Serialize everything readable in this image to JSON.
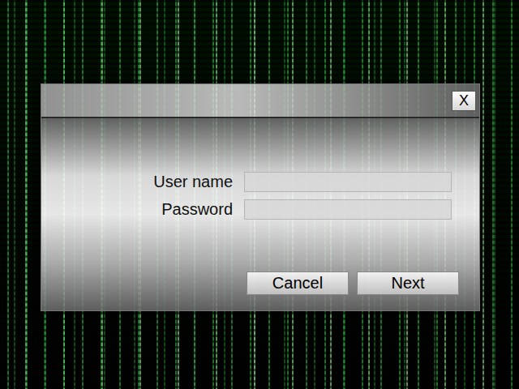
{
  "window": {
    "close": "X"
  },
  "form": {
    "fields": [
      {
        "label": "User name",
        "value": ""
      },
      {
        "label": "Password",
        "value": ""
      }
    ]
  },
  "buttons": [
    "Cancel",
    "Next"
  ]
}
